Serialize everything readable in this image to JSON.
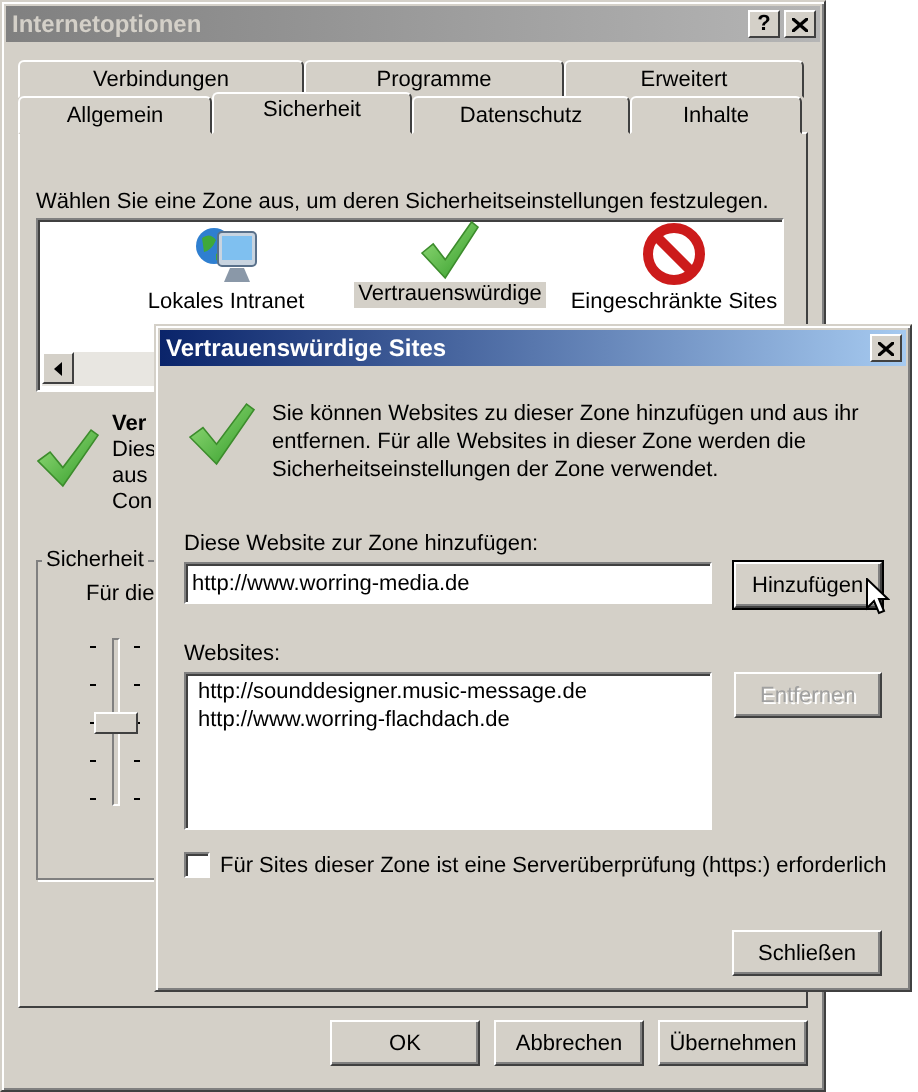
{
  "main_window": {
    "title": "Internetoptionen",
    "help_button": "?"
  },
  "tabs_row_1": [
    {
      "label": "Verbindungen",
      "selected": false
    },
    {
      "label": "Programme",
      "selected": false
    },
    {
      "label": "Erweitert",
      "selected": false
    }
  ],
  "tabs_row_2": [
    {
      "label": "Allgemein",
      "selected": false
    },
    {
      "label": "Sicherheit",
      "selected": true
    },
    {
      "label": "Datenschutz",
      "selected": false
    },
    {
      "label": "Inhalte",
      "selected": false
    }
  ],
  "zone_prompt": "Wählen Sie eine Zone aus, um deren Sicherheitseinstellungen festzulegen.",
  "zones": [
    {
      "kind": "intranet",
      "label": "Lokales Intranet",
      "selected": false
    },
    {
      "kind": "trusted",
      "label": "Vertrauenswürdige",
      "selected": true
    },
    {
      "kind": "restricted",
      "label": "Eingeschränkte Sites",
      "selected": false
    }
  ],
  "zone_info": {
    "title": "Ver",
    "lines": [
      "Dies",
      "aus",
      "Con"
    ]
  },
  "security_level": {
    "group_label": "Sicherheit",
    "caption": "Für die",
    "level": 0.5
  },
  "buttons": [
    {
      "label": "OK",
      "disabled": false
    },
    {
      "label": "Abbrechen",
      "disabled": false
    },
    {
      "label": "Übernehmen",
      "disabled": false
    }
  ],
  "dialog": {
    "title": "Vertrauenswürdige Sites",
    "description": "Sie können Websites zu dieser Zone hinzufügen und aus ihr entfernen. Für alle Websites in dieser Zone werden die Sicherheitseinstellungen der Zone verwendet.",
    "add_label": "Diese Website zur Zone hinzufügen:",
    "add_value": "http://www.worring-media.de",
    "add_button": {
      "label": "Hinzufügen",
      "disabled": false,
      "default": true
    },
    "websites_label": "Websites:",
    "websites": [
      "http://sounddesigner.music-message.de",
      "http://www.worring-flachdach.de"
    ],
    "remove_button": {
      "label": "Entfernen",
      "disabled": true,
      "default": false
    },
    "https_required": {
      "label": "Für Sites dieser Zone ist eine Serverüberprüfung (https:) erforderlich",
      "checked": false
    },
    "close_button": {
      "label": "Schließen",
      "disabled": false,
      "default": false
    }
  }
}
